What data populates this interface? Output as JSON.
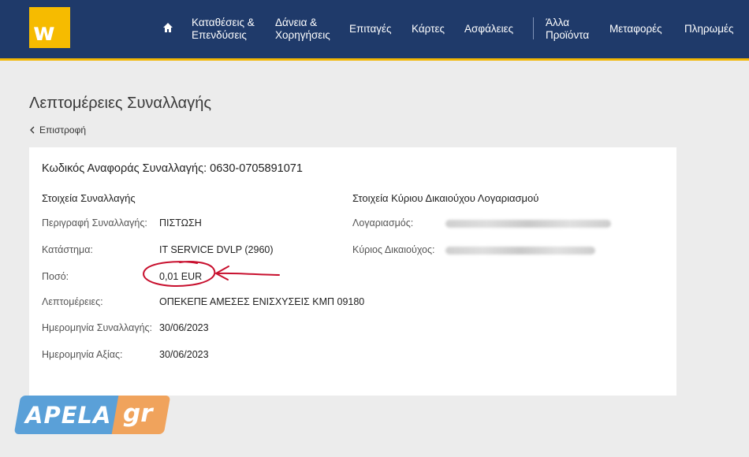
{
  "brand": {
    "logo_letter": "w"
  },
  "nav": {
    "items": [
      {
        "label_line1": "Καταθέσεις &",
        "label_line2": "Επενδύσεις"
      },
      {
        "label_line1": "Δάνεια &",
        "label_line2": "Χορηγήσεις"
      },
      {
        "label_line1": "Επιταγές",
        "label_line2": ""
      },
      {
        "label_line1": "Κάρτες",
        "label_line2": ""
      },
      {
        "label_line1": "Ασφάλειες",
        "label_line2": ""
      },
      {
        "label_line1": "Άλλα",
        "label_line2": "Προϊόντα"
      },
      {
        "label_line1": "Μεταφορές",
        "label_line2": ""
      },
      {
        "label_line1": "Πληρωμές",
        "label_line2": ""
      }
    ]
  },
  "page": {
    "title": "Λεπτομέρειες Συναλλαγής",
    "back_label": "Επιστροφή"
  },
  "transaction": {
    "ref_label": "Κωδικός Αναφοράς Συναλλαγής:",
    "ref_value": "0630-0705891071",
    "details_title": "Στοιχεία Συναλλαγής",
    "rows": [
      {
        "label": "Περιγραφή Συναλλαγής:",
        "value": "ΠΙΣΤΩΣΗ"
      },
      {
        "label": "Κατάστημα:",
        "value": "IT SERVICE DVLP (2960)"
      },
      {
        "label": "Ποσό:",
        "value": "0,01 EUR"
      },
      {
        "label": "Λεπτομέρειες:",
        "value": "ΟΠΕΚΕΠΕ ΑΜΕΣΕΣ ΕΝΙΣΧΥΣΕΙΣ ΚΜΠ 09180"
      },
      {
        "label": "Ημερομηνία Συναλλαγής:",
        "value": "30/06/2023"
      },
      {
        "label": "Ημερομηνία Αξίας:",
        "value": "30/06/2023"
      }
    ],
    "owner_title": "Στοιχεία Κύριου Δικαιούχου Λογαριασμού",
    "owner_rows": [
      {
        "label": "Λογαριασμός:"
      },
      {
        "label": "Κύριος Δικαιούχος:"
      }
    ]
  },
  "watermark": {
    "part1": "APELA",
    "part2": "gr"
  },
  "colors": {
    "header_bg": "#1f3a6a",
    "accent_yellow": "#f2b705",
    "annotation_red": "#c8102e"
  }
}
